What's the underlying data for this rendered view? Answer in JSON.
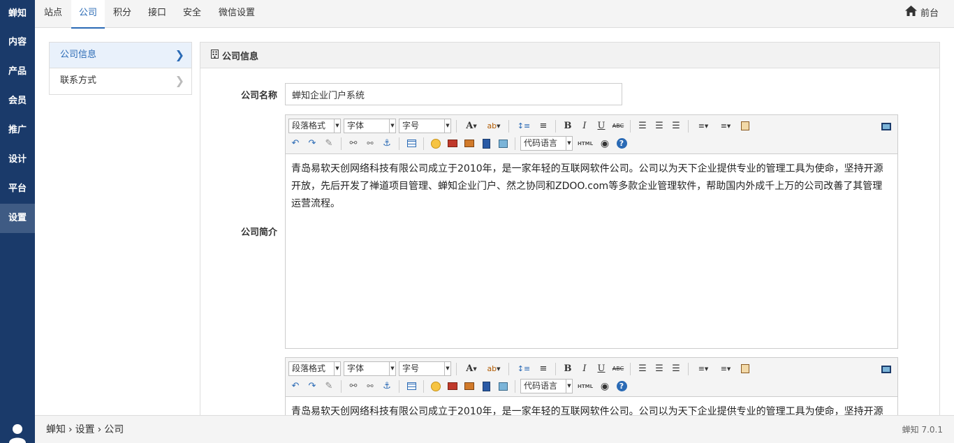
{
  "app": {
    "logo": "蝉知"
  },
  "sidebar": {
    "items": [
      {
        "label": "内容"
      },
      {
        "label": "产品"
      },
      {
        "label": "会员"
      },
      {
        "label": "推广"
      },
      {
        "label": "设计"
      },
      {
        "label": "平台"
      },
      {
        "label": "设置",
        "active": true
      }
    ]
  },
  "topnav": {
    "tabs": [
      {
        "label": "站点"
      },
      {
        "label": "公司",
        "active": true
      },
      {
        "label": "积分"
      },
      {
        "label": "接口"
      },
      {
        "label": "安全"
      },
      {
        "label": "微信设置"
      }
    ],
    "front_label": "前台"
  },
  "submenu": {
    "items": [
      {
        "label": "公司信息",
        "active": true
      },
      {
        "label": "联系方式"
      }
    ]
  },
  "panel": {
    "title": "公司信息",
    "name_label": "公司名称",
    "name_value": "蝉知企业门户系统",
    "desc_label": "公司简介"
  },
  "editor": {
    "paragraph_select": "段落格式",
    "font_select": "字体",
    "size_select": "字号",
    "code_select": "代码语言",
    "html_label": "HTML",
    "content": "青岛易软天创网络科技有限公司成立于2010年，是一家年轻的互联网软件公司。公司以为天下企业提供专业的管理工具为使命，坚持开源开放，先后开发了禅道项目管理、蝉知企业门户、然之协同和ZDOO.com等多款企业管理软件，帮助国内外成千上万的公司改善了其管理运营流程。"
  },
  "footer": {
    "crumbs": [
      "蝉知",
      "设置",
      "公司"
    ],
    "version": "蝉知 7.0.1"
  },
  "colors": {
    "sidebar_bg": "#1a3a6a",
    "sidebar_active": "#3f5b84",
    "accent": "#2a6ab5"
  }
}
